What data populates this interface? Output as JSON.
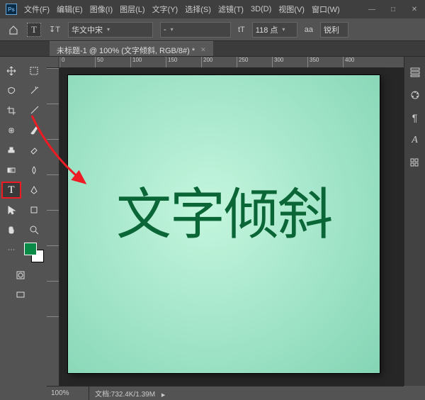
{
  "menu": {
    "items": [
      "文件(F)",
      "编辑(E)",
      "图像(I)",
      "图层(L)",
      "文字(Y)",
      "选择(S)",
      "滤镜(T)",
      "3D(D)",
      "视图(V)",
      "窗口(W)"
    ]
  },
  "options": {
    "tool_glyph": "T",
    "orient_glyph": "↧T",
    "font": "华文中宋",
    "style": "-",
    "size_glyph": "tT",
    "size": "118 点",
    "aa_label": "aa",
    "aa_value": "锐利"
  },
  "tab": {
    "title": "未标题-1 @ 100% (文字倾斜, RGB/8#) *"
  },
  "ruler_marks": [
    "0",
    "50",
    "100",
    "150",
    "200",
    "250",
    "300",
    "350",
    "400"
  ],
  "canvas": {
    "text": "文字倾斜",
    "bg_inner": "#c4f6de",
    "bg_outer": "#84d5b5",
    "text_color": "#0a6636",
    "fg_swatch": "#0a8a47"
  },
  "status": {
    "zoom": "100%",
    "doc_label": "文档:",
    "doc_value": "732.4K/1.39M"
  }
}
